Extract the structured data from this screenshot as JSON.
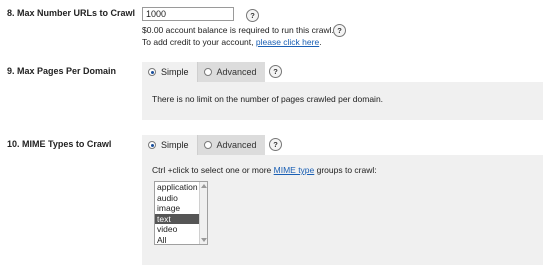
{
  "section8": {
    "label": "8.  Max Number URLs to Crawl",
    "input_value": "1000",
    "help": "?",
    "balance_note": "$0.00 account balance is required to run this crawl.",
    "credit_note_prefix": "To add credit to your account, ",
    "credit_link": "please click here",
    "credit_note_suffix": "."
  },
  "section9": {
    "label": "9.  Max Pages Per Domain",
    "tabs": [
      {
        "label": "Simple",
        "selected": true
      },
      {
        "label": "Advanced",
        "selected": false
      }
    ],
    "help": "?",
    "message": "There is no limit on the number of pages crawled per domain."
  },
  "section10": {
    "label": "10.  MIME Types to Crawl",
    "tabs": [
      {
        "label": "Simple",
        "selected": true
      },
      {
        "label": "Advanced",
        "selected": false
      }
    ],
    "help": "?",
    "instruction_prefix": "Ctrl +click to select one or more ",
    "instruction_link": "MIME type",
    "instruction_suffix": " groups to crawl:",
    "options": [
      "application",
      "audio",
      "image",
      "text",
      "video",
      "All"
    ],
    "selected_option": "text"
  }
}
